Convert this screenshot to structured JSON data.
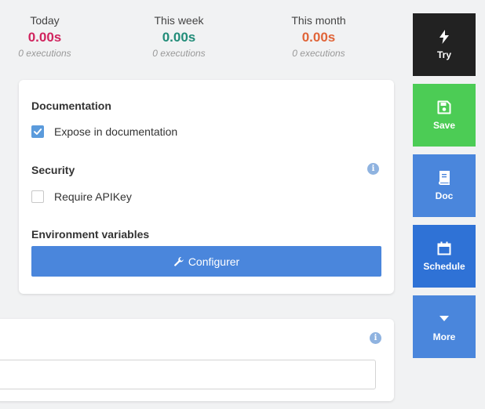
{
  "stats": [
    {
      "label": "Today",
      "value": "0.00s",
      "sub": "0 executions",
      "color": "#d0245e"
    },
    {
      "label": "This week",
      "value": "0.00s",
      "sub": "0 executions",
      "color": "#218c78"
    },
    {
      "label": "This month",
      "value": "0.00s",
      "sub": "0 executions",
      "color": "#e06438"
    }
  ],
  "settings": {
    "documentation": {
      "title": "Documentation",
      "checkbox_label": "Expose in documentation",
      "checked": true
    },
    "security": {
      "title": "Security",
      "checkbox_label": "Require APIKey",
      "checked": false
    },
    "env": {
      "title": "Environment variables",
      "button_label": "Configurer"
    }
  },
  "lower_card": {
    "input_value": ""
  },
  "sidebar": [
    {
      "label": "Try",
      "icon": "bolt-icon",
      "color": "#222222"
    },
    {
      "label": "Save",
      "icon": "save-icon",
      "color": "#4ccc55"
    },
    {
      "label": "Doc",
      "icon": "book-icon",
      "color": "#4a86dc"
    },
    {
      "label": "Schedule",
      "icon": "calendar-icon",
      "color": "#2f72d6"
    },
    {
      "label": "More",
      "icon": "caret-down-icon",
      "color": "#4a86dc"
    }
  ]
}
